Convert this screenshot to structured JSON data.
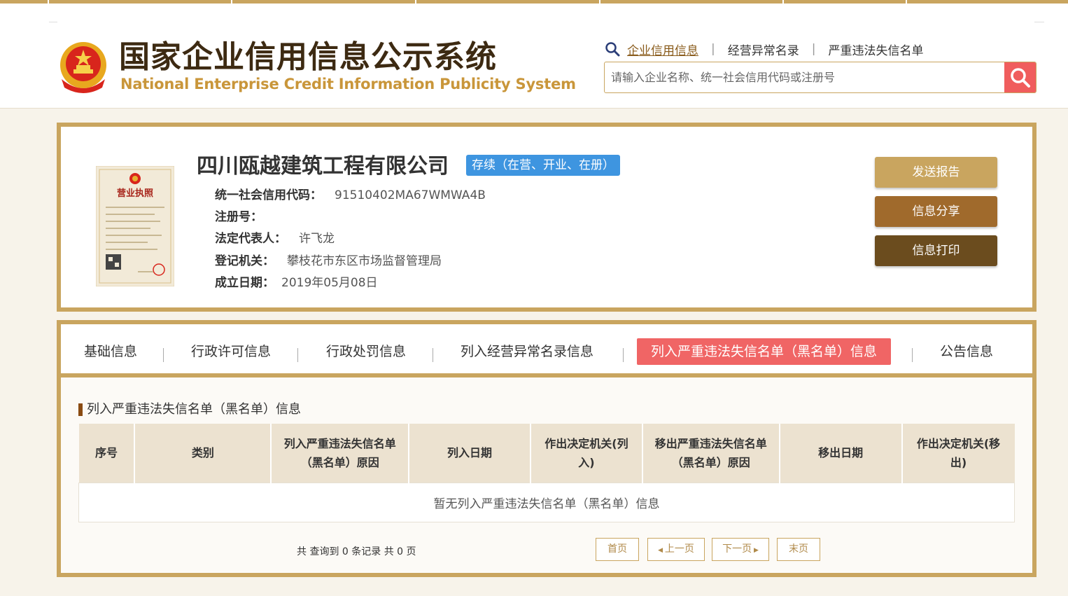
{
  "header": {
    "logo_cn": "国家企业信用信息公示系统",
    "logo_en": "National Enterprise Credit Information Publicity System",
    "nav": [
      "企业信用信息",
      "经营异常名录",
      "严重违法失信名单"
    ],
    "search_placeholder": "请输入企业名称、统一社会信用代码或注册号"
  },
  "company": {
    "name": "四川瓯越建筑工程有限公司",
    "status": "存续（在营、开业、在册）",
    "fields": [
      {
        "label": "统一社会信用代码：",
        "value": "91510402MA67WMWA4B"
      },
      {
        "label": "注册号：",
        "value": ""
      },
      {
        "label": "法定代表人：",
        "value": "许飞龙"
      },
      {
        "label": "登记机关：",
        "value": "攀枝花市东区市场监督管理局"
      },
      {
        "label": "成立日期：",
        "value": "2019年05月08日"
      }
    ],
    "buttons": {
      "send": "发送报告",
      "share": "信息分享",
      "print": "信息打印"
    },
    "license_title": "营业执照"
  },
  "tabs": [
    "基础信息",
    "行政许可信息",
    "行政处罚信息",
    "列入经营异常名录信息",
    "列入严重违法失信名单（黑名单）信息",
    "公告信息"
  ],
  "section": {
    "title": "列入严重违法失信名单（黑名单）信息",
    "columns": [
      "序号",
      "类别",
      "列入严重违法失信名单（黑名单）原因",
      "列入日期",
      "作出决定机关(列入)",
      "移出严重违法失信名单（黑名单）原因",
      "移出日期",
      "作出决定机关(移出)"
    ],
    "empty_message": "暂无列入严重违法失信名单（黑名单）信息"
  },
  "pager": {
    "info": "共 查询到 0 条记录 共 0 页",
    "first": "首页",
    "prev": "上一页",
    "next": "下一页",
    "last": "末页"
  },
  "colors": {
    "gold": "#c9a55f",
    "active_tab": "#f06565",
    "status_blue": "#3e95e0",
    "search_btn": "#f05d5d"
  }
}
